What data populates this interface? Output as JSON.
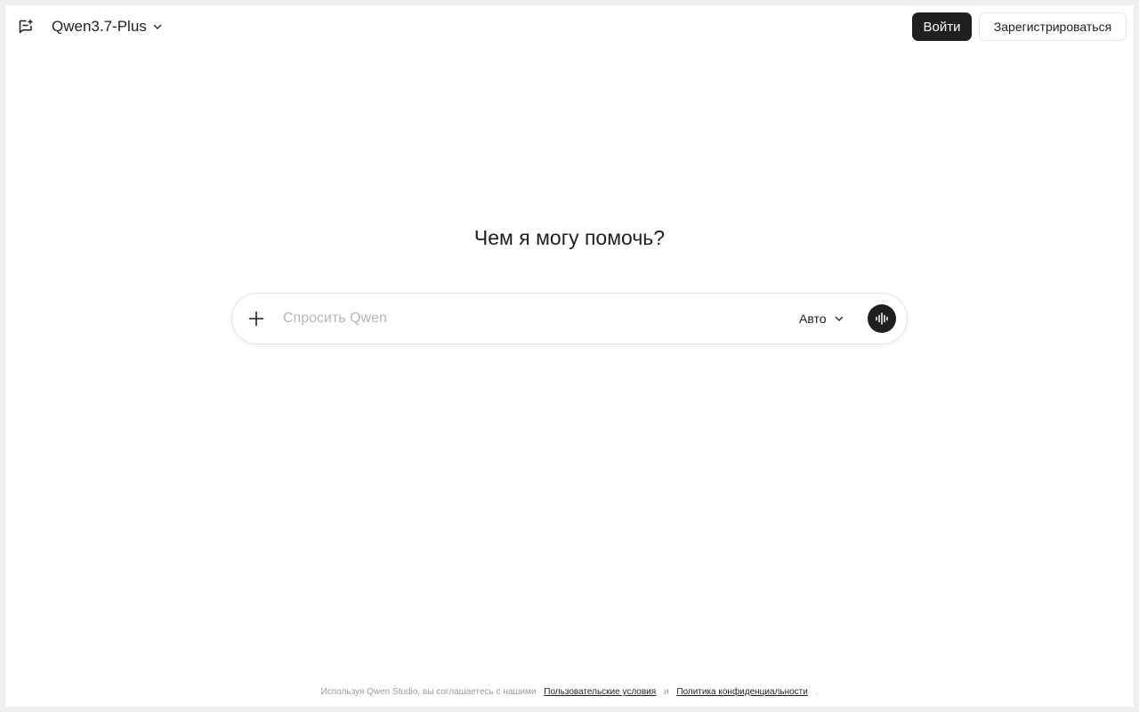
{
  "header": {
    "model_name": "Qwen3.7-Plus",
    "login_label": "Войти",
    "signup_label": "Зарегистрироваться"
  },
  "main": {
    "heading": "Чем я могу помочь?"
  },
  "composer": {
    "placeholder": "Спросить Qwen",
    "value": "",
    "mode_label": "Авто"
  },
  "footer": {
    "prefix": "Используя Qwen Studio, вы соглашаетесь с нашими",
    "terms_link": "Пользовательские условия",
    "and": "и",
    "privacy_link": "Политика конфиденциальности",
    "suffix": "."
  },
  "icons": {
    "new_chat": "new-chat-icon",
    "model_dropdown": "chevron-down-icon",
    "attach": "plus-icon",
    "mode_dropdown": "chevron-down-icon",
    "voice": "voice-waveform-icon"
  },
  "colors": {
    "primary": "#1f1f1f",
    "background": "#ffffff",
    "frame": "#efefef",
    "placeholder": "#b5b5b5",
    "muted_text": "#9a9a9a"
  }
}
